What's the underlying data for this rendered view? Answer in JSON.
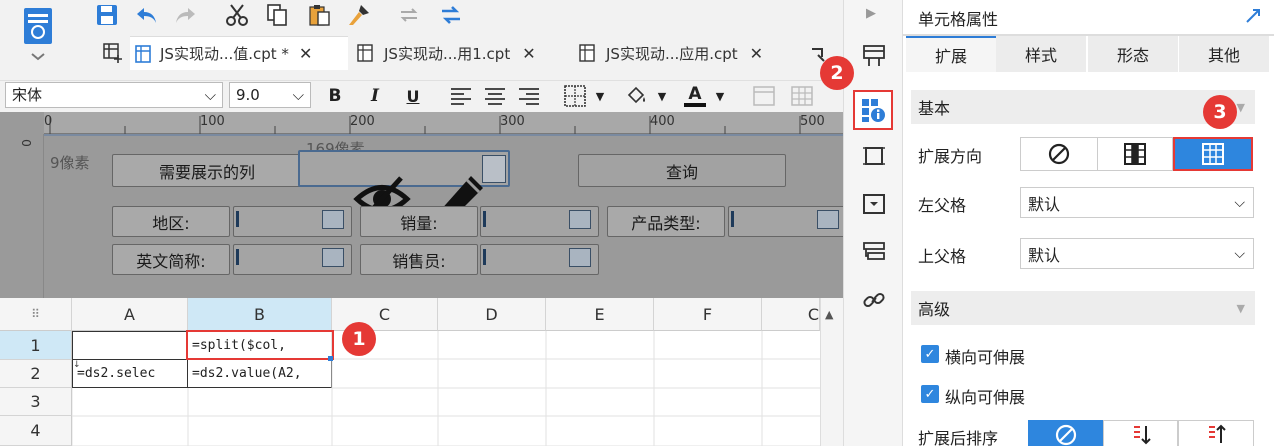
{
  "tabs": [
    {
      "label": "JS实现动...值.cpt *"
    },
    {
      "label": "JS实现动...用1.cpt"
    },
    {
      "label": "JS实现动...应用.cpt"
    }
  ],
  "format": {
    "font": "宋体",
    "size": "9.0",
    "bold": "B",
    "italic": "I",
    "underline": "U",
    "font_color_letter": "A"
  },
  "ruler": {
    "ticks": [
      "0",
      "100",
      "200",
      "300",
      "400",
      "500"
    ],
    "v_tick": "0",
    "size_label": "9像素",
    "width_label": "169像素"
  },
  "form": {
    "col_label": "需要展示的列",
    "query_button": "查询",
    "region_label": "地区:",
    "sales_label": "销量:",
    "product_type_label": "产品类型:",
    "abbr_label": "英文简称:",
    "salesman_label": "销售员:"
  },
  "grid": {
    "columns": [
      "A",
      "B",
      "C",
      "D",
      "E",
      "F",
      "C"
    ],
    "rows": [
      "1",
      "2",
      "3",
      "4"
    ],
    "cells": {
      "B1": "=split($col,",
      "A2": "=ds2.selec",
      "B2": "=ds2.value(A2,"
    }
  },
  "panel": {
    "title": "单元格属性",
    "tabs": [
      "扩展",
      "样式",
      "形态",
      "其他"
    ],
    "basic_section": "基本",
    "expand_direction_label": "扩展方向",
    "left_parent_label": "左父格",
    "left_parent_value": "默认",
    "upper_parent_label": "上父格",
    "upper_parent_value": "默认",
    "advanced_section": "高级",
    "h_expand_label": "横向可伸展",
    "v_expand_label": "纵向可伸展",
    "sort_label": "扩展后排序",
    "check_mark": "✓"
  },
  "badges": [
    "1",
    "2",
    "3"
  ],
  "colors": {
    "accent": "#2e86de",
    "badge": "#e53935",
    "tab_active": "#2e7dd7"
  }
}
